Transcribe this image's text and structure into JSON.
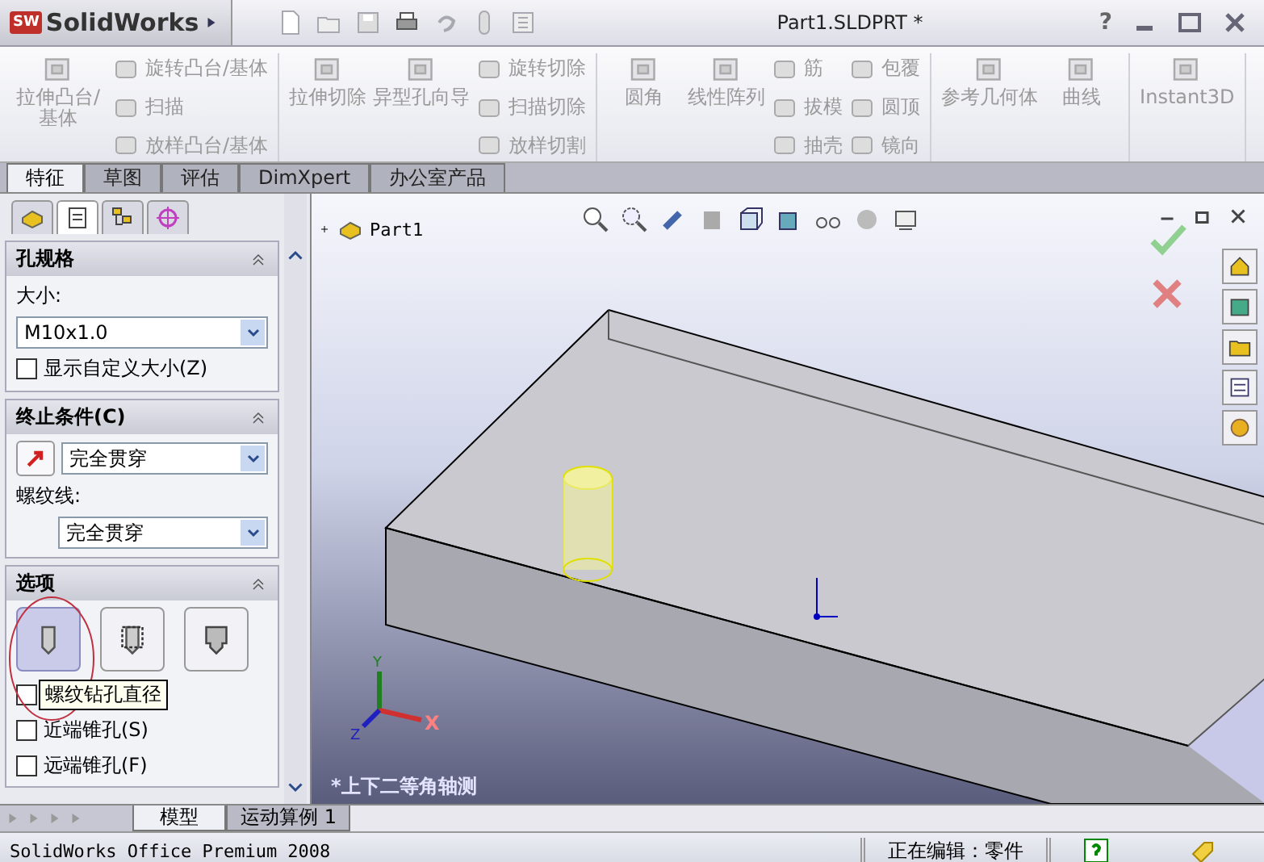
{
  "app": {
    "logo_badge": "SW",
    "logo": "SolidWorks"
  },
  "window": {
    "title": "Part1.SLDPRT *",
    "help": "?"
  },
  "ribbon": {
    "groups": [
      {
        "columns": [
          [
            {
              "kind": "large",
              "label": "拉伸凸台/基体",
              "disabled": true
            }
          ],
          [
            {
              "kind": "small",
              "label": "旋转凸台/基体",
              "disabled": true
            },
            {
              "kind": "small",
              "label": "扫描",
              "disabled": true
            },
            {
              "kind": "small",
              "label": "放样凸台/基体",
              "disabled": true
            }
          ]
        ]
      },
      {
        "columns": [
          [
            {
              "kind": "large",
              "label": "拉伸切除",
              "disabled": true
            }
          ],
          [
            {
              "kind": "large",
              "label": "异型孔向导",
              "disabled": true
            }
          ],
          [
            {
              "kind": "small",
              "label": "旋转切除",
              "disabled": true
            },
            {
              "kind": "small",
              "label": "扫描切除",
              "disabled": true
            },
            {
              "kind": "small",
              "label": "放样切割",
              "disabled": true
            }
          ]
        ]
      },
      {
        "columns": [
          [
            {
              "kind": "large",
              "label": "圆角",
              "disabled": true
            }
          ],
          [
            {
              "kind": "large",
              "label": "线性阵列",
              "disabled": true
            }
          ],
          [
            {
              "kind": "small",
              "label": "筋",
              "disabled": true
            },
            {
              "kind": "small",
              "label": "拔模",
              "disabled": true
            },
            {
              "kind": "small",
              "label": "抽壳",
              "disabled": true
            }
          ],
          [
            {
              "kind": "small",
              "label": "包覆",
              "disabled": true
            },
            {
              "kind": "small",
              "label": "圆顶",
              "disabled": true
            },
            {
              "kind": "small",
              "label": "镜向",
              "disabled": true
            }
          ]
        ]
      },
      {
        "columns": [
          [
            {
              "kind": "large",
              "label": "参考几何体",
              "disabled": true
            }
          ],
          [
            {
              "kind": "large",
              "label": "曲线",
              "disabled": true
            }
          ]
        ]
      },
      {
        "columns": [
          [
            {
              "kind": "large",
              "label": "Instant3D",
              "disabled": true
            }
          ]
        ]
      }
    ]
  },
  "tabs": [
    {
      "label": "特征",
      "selected": true
    },
    {
      "label": "草图",
      "selected": false
    },
    {
      "label": "评估",
      "selected": false
    },
    {
      "label": "DimXpert",
      "selected": false
    },
    {
      "label": "办公室产品",
      "selected": false
    }
  ],
  "panel_tabs": [
    {
      "kind": "tree",
      "selected": false
    },
    {
      "kind": "properties",
      "selected": true
    },
    {
      "kind": "configuration",
      "selected": false
    },
    {
      "kind": "display",
      "selected": false
    }
  ],
  "hole_spec": {
    "title": "孔规格",
    "size_label": "大小:",
    "size_value": "M10x1.0",
    "custom_size": {
      "label": "显示自定义大小(Z)",
      "checked": false
    }
  },
  "end_condition": {
    "title": "终止条件(C)",
    "value": "完全贯穿",
    "thread_label": "螺纹线:",
    "thread_value": "完全贯穿"
  },
  "options": {
    "title": "选项",
    "hole_types": [
      {
        "kind": "plain",
        "selected": true
      },
      {
        "kind": "cosmetic",
        "selected": false
      },
      {
        "kind": "stepped",
        "selected": false
      }
    ],
    "tooltip": "螺纹钻孔直径",
    "checkboxes": [
      {
        "checked": false
      },
      {
        "label": "近端锥孔(S)",
        "checked": false
      },
      {
        "label": "远端锥孔(F)",
        "checked": false
      }
    ]
  },
  "viewport": {
    "tree_root": "Part1",
    "view_label": "*上下二等角轴测",
    "axes": {
      "x": "X",
      "y": "Y",
      "z": "Z"
    }
  },
  "bottom_tabs": [
    {
      "label": "模型",
      "selected": true
    },
    {
      "label": "运动算例 1",
      "selected": false
    }
  ],
  "status_bar": {
    "product": "SolidWorks Office Premium 2008",
    "mode": "正在编辑：零件"
  }
}
